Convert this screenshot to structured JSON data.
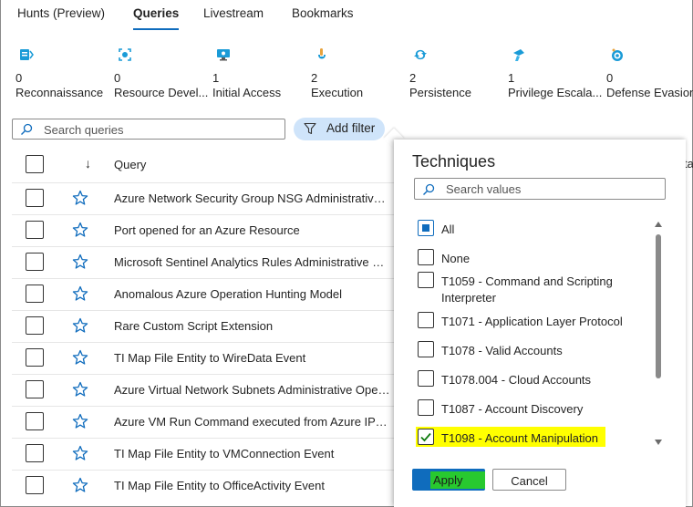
{
  "tabs": [
    {
      "label": "Hunts (Preview)",
      "active": false
    },
    {
      "label": "Queries",
      "active": true
    },
    {
      "label": "Livestream",
      "active": false
    },
    {
      "label": "Bookmarks",
      "active": false
    }
  ],
  "tactics": [
    {
      "count": "0",
      "name": "Reconnaissance",
      "icon": "reconnaissance-icon"
    },
    {
      "count": "0",
      "name": "Resource Devel...",
      "icon": "resource-development-icon"
    },
    {
      "count": "1",
      "name": "Initial Access",
      "icon": "initial-access-icon"
    },
    {
      "count": "2",
      "name": "Execution",
      "icon": "execution-icon"
    },
    {
      "count": "2",
      "name": "Persistence",
      "icon": "persistence-icon"
    },
    {
      "count": "1",
      "name": "Privilege Escala...",
      "icon": "privilege-escalation-icon"
    },
    {
      "count": "0",
      "name": "Defense Evasion",
      "icon": "defense-evasion-icon"
    }
  ],
  "search": {
    "placeholder": "Search queries",
    "value": ""
  },
  "filter_button": {
    "label": "Add filter"
  },
  "table": {
    "sort_indicator": "↓",
    "column_query": "Query",
    "behind_panel_fragment": "ta",
    "rows": [
      {
        "name": "Azure Network Security Group NSG Administrative Operations"
      },
      {
        "name": "Port opened for an Azure Resource"
      },
      {
        "name": "Microsoft Sentinel Analytics Rules Administrative Operations"
      },
      {
        "name": "Anomalous Azure Operation Hunting Model"
      },
      {
        "name": "Rare Custom Script Extension"
      },
      {
        "name": "TI Map File Entity to WireData Event"
      },
      {
        "name": "Azure Virtual Network Subnets Administrative Operations"
      },
      {
        "name": "Azure VM Run Command executed from Azure IP address"
      },
      {
        "name": "TI Map File Entity to VMConnection Event"
      },
      {
        "name": "TI Map File Entity to OfficeActivity Event"
      }
    ]
  },
  "techniques_panel": {
    "title": "Techniques",
    "search_placeholder": "Search values",
    "options": [
      {
        "label": "All",
        "state": "indeterminate"
      },
      {
        "label": "None",
        "state": "unchecked"
      },
      {
        "label": "T1059 - Command and Scripting Interpreter",
        "state": "unchecked"
      },
      {
        "label": "T1071 - Application Layer Protocol",
        "state": "unchecked"
      },
      {
        "label": "T1078 - Valid Accounts",
        "state": "unchecked"
      },
      {
        "label": "T1078.004 - Cloud Accounts",
        "state": "unchecked"
      },
      {
        "label": "T1087 - Account Discovery",
        "state": "unchecked"
      },
      {
        "label": "T1098 - Account Manipulation",
        "state": "checked",
        "highlighted": true
      }
    ],
    "apply_label": "Apply",
    "cancel_label": "Cancel"
  },
  "colors": {
    "accent": "#0f6cbd",
    "highlight_yellow": "#ffff00",
    "highlight_green": "#2bd41f",
    "filter_pill": "#cfe4fa"
  }
}
